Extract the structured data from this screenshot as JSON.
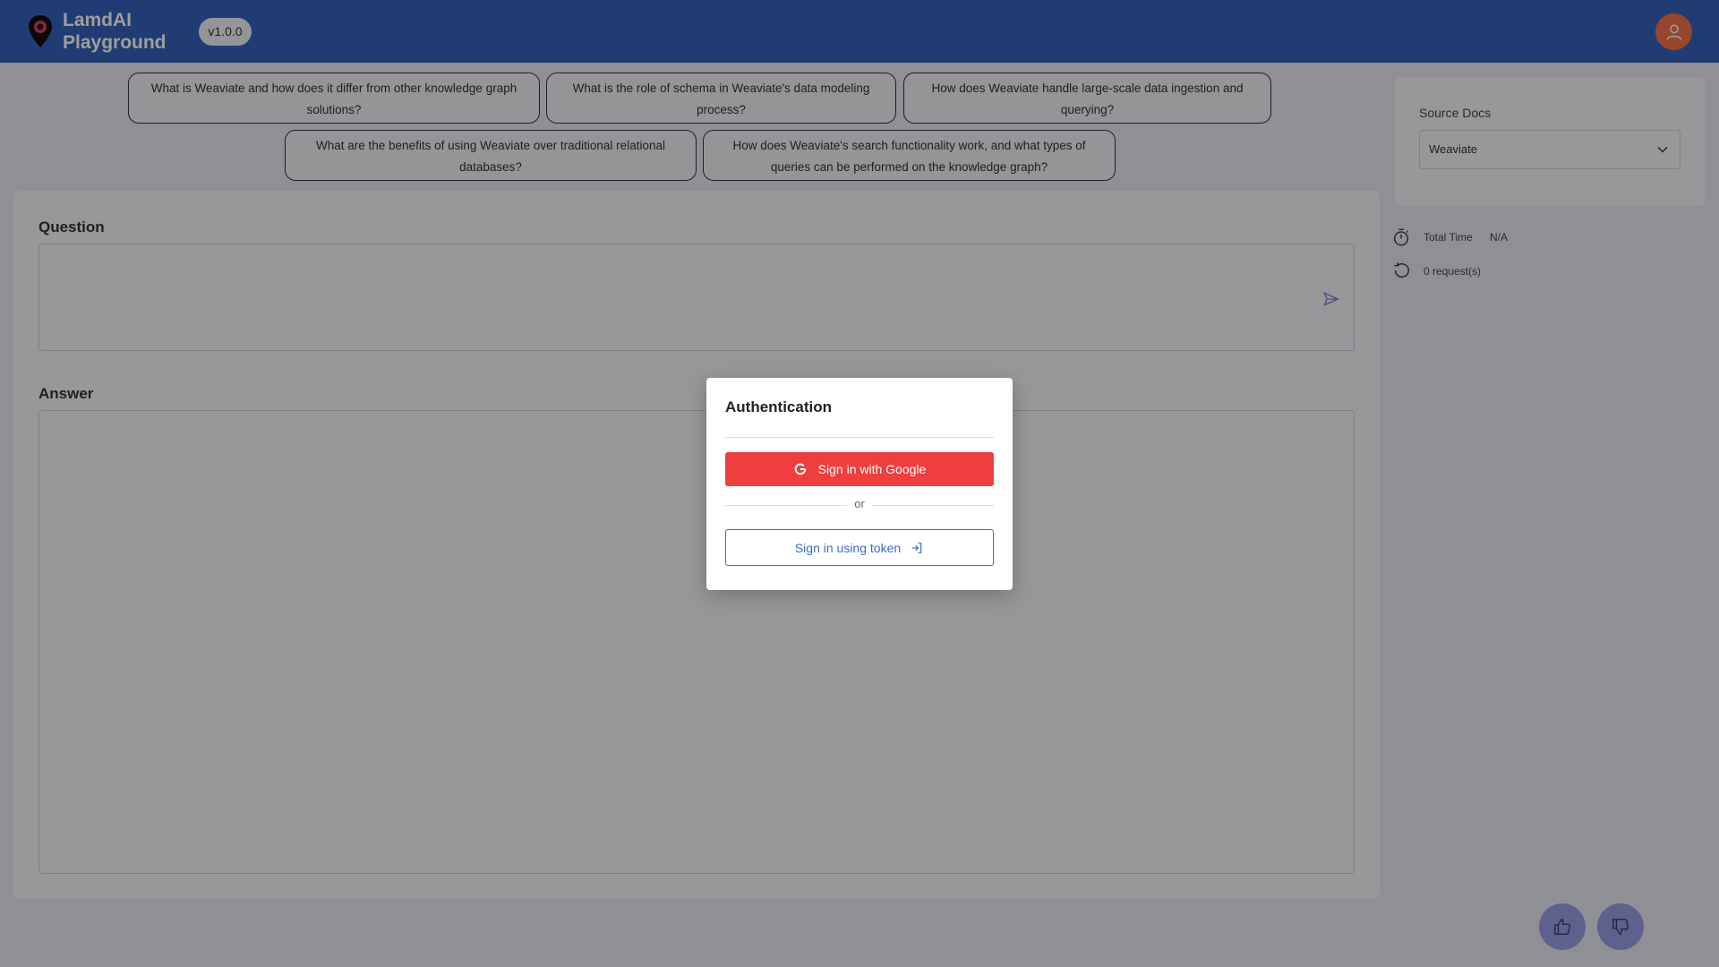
{
  "header": {
    "title_line1": "LamdAI",
    "title_line2": "Playground",
    "version": "v1.0.0"
  },
  "suggestions": [
    "What is Weaviate and how does it differ from other knowledge graph solutions?",
    "What is the role of schema in Weaviate's data modeling process?",
    "How does Weaviate handle large-scale data ingestion and querying?",
    "What are the benefits of using Weaviate over traditional relational databases?",
    "How does Weaviate's search functionality work, and what types of queries can be performed on the knowledge graph?"
  ],
  "main": {
    "question_label": "Question",
    "answer_label": "Answer",
    "question_value": "",
    "answer_value": ""
  },
  "sidebar": {
    "source_docs_label": "Source Docs",
    "source_docs_value": "Weaviate",
    "total_time_label": "Total Time",
    "total_time_value": "N/A",
    "requests_text": "0 request(s)"
  },
  "modal": {
    "title": "Authentication",
    "google_button": "Sign in with Google",
    "or_text": "or",
    "token_button": "Sign in using token"
  },
  "colors": {
    "header_bg": "#3461b8",
    "google_red": "#ef3e3e",
    "token_blue": "#3a6cc4",
    "avatar": "#f4714a",
    "feedback": "#9a9de4"
  },
  "icons": {
    "logo": "location-pin-logo-icon",
    "avatar": "user-icon",
    "send": "send-icon",
    "chevron": "chevron-down-icon",
    "timer": "timer-icon",
    "history": "history-icon",
    "thumbs_up": "thumbs-up-icon",
    "thumbs_down": "thumbs-down-icon",
    "google": "google-icon",
    "login": "login-icon"
  }
}
